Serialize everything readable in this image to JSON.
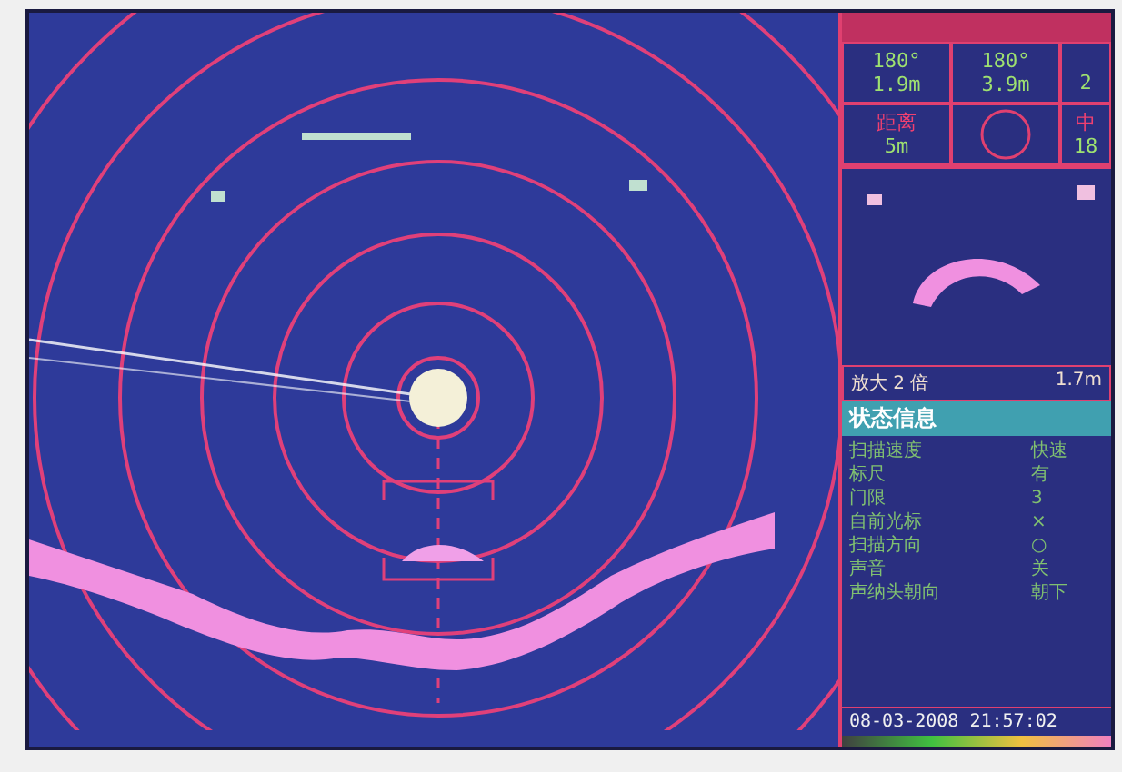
{
  "readouts": [
    {
      "kind": "reading",
      "bearing": "180°",
      "range": "1.9m"
    },
    {
      "kind": "reading",
      "bearing": "180°",
      "range": "3.9m"
    },
    {
      "kind": "partial",
      "range": "2"
    },
    {
      "kind": "label",
      "label": "距离",
      "value": "5m"
    },
    {
      "kind": "circle"
    },
    {
      "kind": "label",
      "label": "中",
      "value": "18"
    }
  ],
  "magnify": {
    "label": "放大 2 倍",
    "value": "1.7m"
  },
  "status": {
    "title": "状态信息",
    "rows": [
      {
        "label": "扫描速度",
        "value": "快速"
      },
      {
        "label": "标尺",
        "value": "有"
      },
      {
        "label": "门限",
        "value": "3"
      },
      {
        "label": "自前光标",
        "value": "×"
      },
      {
        "label": "扫描方向",
        "value": "○"
      },
      {
        "label": "声音",
        "value": "关"
      },
      {
        "label": "声纳头朝向",
        "value": "朝下"
      }
    ]
  },
  "timestamp": "08-03-2008 21:57:02"
}
